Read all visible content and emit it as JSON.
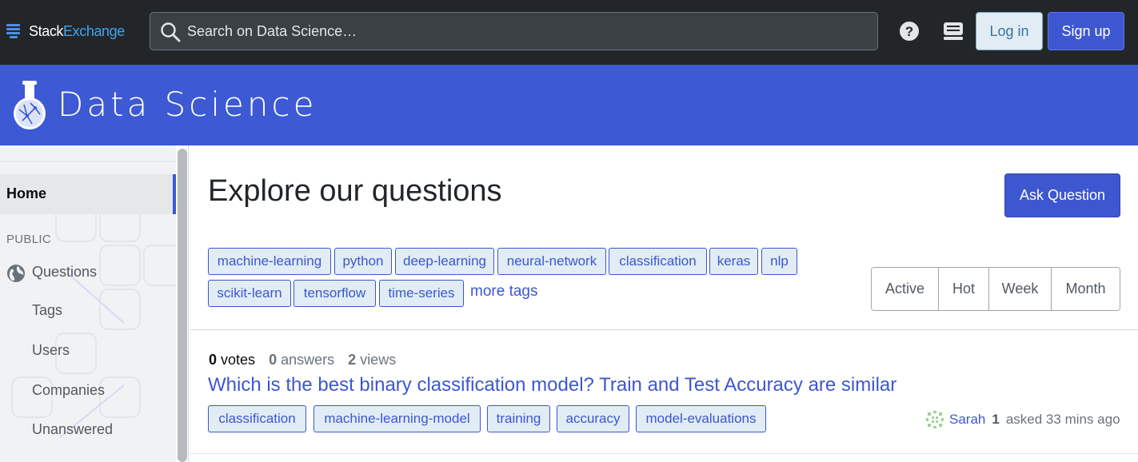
{
  "topbar": {
    "logo_part1": "Stack",
    "logo_part2": "Exchange",
    "search_placeholder": "Search on Data Science…",
    "login_label": "Log in",
    "signup_label": "Sign up",
    "icons": [
      "search-icon",
      "help-icon",
      "inbox-icon"
    ]
  },
  "site": {
    "name": "Data Science",
    "icon": "flask-icon",
    "brand_color": "#3d59d4"
  },
  "sidebar": {
    "home_label": "Home",
    "section_label": "PUBLIC",
    "items": [
      {
        "label": "Questions",
        "icon": "globe-icon"
      },
      {
        "label": "Tags"
      },
      {
        "label": "Users"
      },
      {
        "label": "Companies"
      },
      {
        "label": "Unanswered"
      }
    ]
  },
  "main": {
    "title": "Explore our questions",
    "ask_button": "Ask Question",
    "tags": [
      "machine-learning",
      "python",
      "deep-learning",
      "neural-network",
      "classification",
      "keras",
      "nlp",
      "scikit-learn",
      "tensorflow",
      "time-series"
    ],
    "more_tags": "more tags",
    "filters": [
      "Active",
      "Hot",
      "Week",
      "Month"
    ]
  },
  "question": {
    "votes_count": "0",
    "votes_label": "votes",
    "answers_count": "0",
    "answers_label": "answers",
    "views_count": "2",
    "views_label": "views",
    "title": "Which is the best binary classification model? Train and Test Accuracy are similar",
    "tags": [
      "classification",
      "machine-learning-model",
      "training",
      "accuracy",
      "model-evaluations"
    ],
    "user": "Sarah",
    "reputation": "1",
    "asked": "asked 33 mins ago"
  }
}
